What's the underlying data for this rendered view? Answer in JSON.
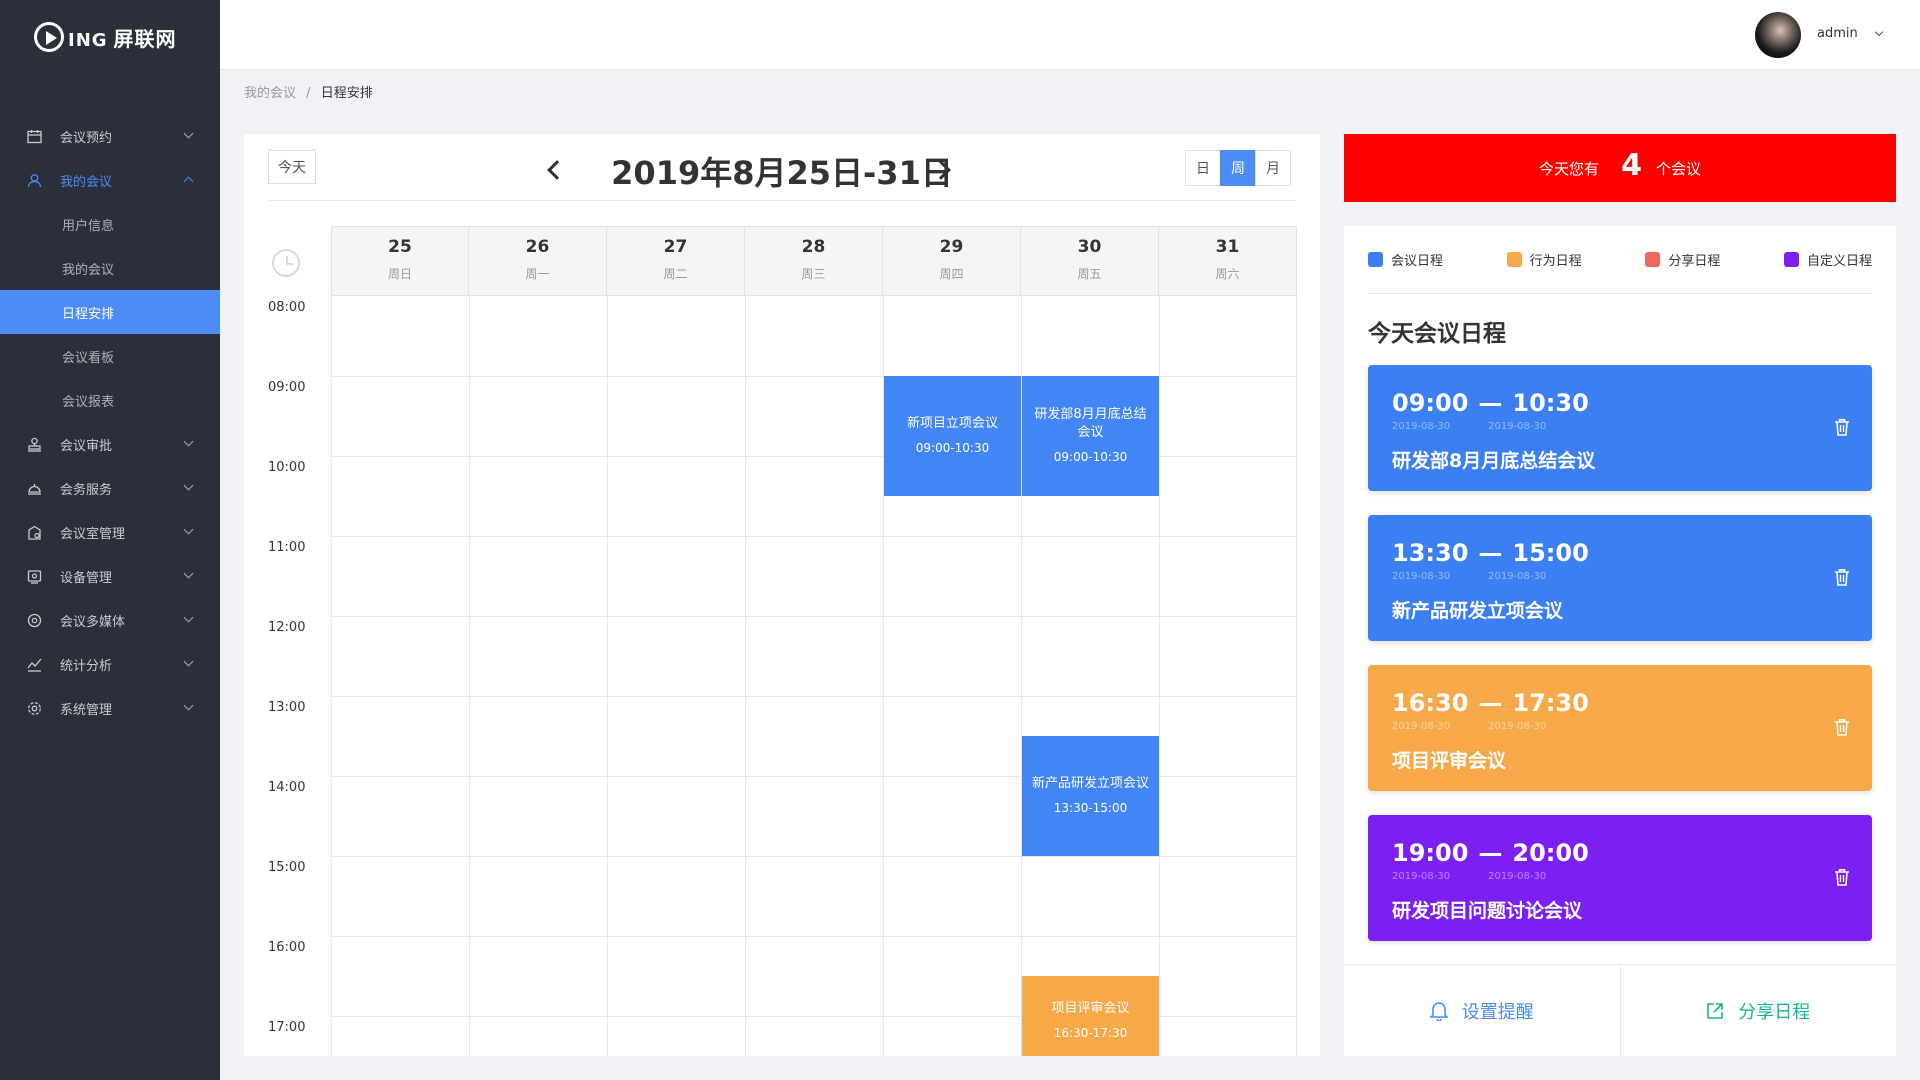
{
  "app": {
    "logo_mark": "ING",
    "logo_name": "屏联网"
  },
  "sidebar": {
    "items": [
      {
        "label": "会议预约",
        "icon": "calendar-icon"
      },
      {
        "label": "我的会议",
        "icon": "user-icon",
        "open": true,
        "children": [
          "用户信息",
          "我的会议",
          "日程安排",
          "会议看板",
          "会议报表"
        ],
        "active_child": "日程安排"
      },
      {
        "label": "会议审批",
        "icon": "stamp-icon"
      },
      {
        "label": "会务服务",
        "icon": "service-icon"
      },
      {
        "label": "会议室管理",
        "icon": "room-icon"
      },
      {
        "label": "设备管理",
        "icon": "device-icon"
      },
      {
        "label": "会议多媒体",
        "icon": "media-icon"
      },
      {
        "label": "统计分析",
        "icon": "chart-icon"
      },
      {
        "label": "系统管理",
        "icon": "gear-icon"
      }
    ]
  },
  "header": {
    "user_name": "admin"
  },
  "breadcrumb": {
    "parent": "我的会议",
    "separator": "/",
    "current": "日程安排"
  },
  "calendar": {
    "today_label": "今天",
    "range_title": "2019年8月25日-31日",
    "views": [
      "日",
      "周",
      "月"
    ],
    "active_view": "周",
    "days": [
      {
        "num": "25",
        "weekday": "周日"
      },
      {
        "num": "26",
        "weekday": "周一"
      },
      {
        "num": "27",
        "weekday": "周二"
      },
      {
        "num": "28",
        "weekday": "周三"
      },
      {
        "num": "29",
        "weekday": "周四"
      },
      {
        "num": "30",
        "weekday": "周五"
      },
      {
        "num": "31",
        "weekday": "周六"
      }
    ],
    "hours": [
      "08:00",
      "09:00",
      "10:00",
      "11:00",
      "12:00",
      "13:00",
      "14:00",
      "15:00",
      "16:00",
      "17:00"
    ],
    "events": [
      {
        "title": "新项目立项会议",
        "time": "09:00-10:30",
        "day": 4,
        "start": 9.0,
        "end": 10.5,
        "color": "#4285f4"
      },
      {
        "title": "研发部8月月底总结会议",
        "time": "09:00-10:30",
        "day": 5,
        "start": 9.0,
        "end": 10.5,
        "color": "#4285f4"
      },
      {
        "title": "新产品研发立项会议",
        "time": "13:30-15:00",
        "day": 5,
        "start": 13.5,
        "end": 15.0,
        "color": "#4285f4"
      },
      {
        "title": "项目评审会议",
        "time": "16:30-17:30",
        "day": 5,
        "start": 16.5,
        "end": 17.5,
        "color": "#f7a94a"
      }
    ]
  },
  "banner": {
    "prefix": "今天您有",
    "count": "4",
    "suffix": "个会议",
    "color": "#ff0000"
  },
  "legend": [
    {
      "label": "会议日程",
      "color": "#3b7ff2"
    },
    {
      "label": "行为日程",
      "color": "#f7a94a"
    },
    {
      "label": "分享日程",
      "color": "#f26660"
    },
    {
      "label": "自定义日程",
      "color": "#7b1ff2"
    }
  ],
  "today_schedule": {
    "title": "今天会议日程",
    "cards": [
      {
        "start": "09:00",
        "end": "10:30",
        "date_start": "2019-08-30",
        "date_end": "2019-08-30",
        "name": "研发部8月月底总结会议",
        "color": "#3b7ff2"
      },
      {
        "start": "13:30",
        "end": "15:00",
        "date_start": "2019-08-30",
        "date_end": "2019-08-30",
        "name": "新产品研发立项会议",
        "color": "#3b7ff2"
      },
      {
        "start": "16:30",
        "end": "17:30",
        "date_start": "2019-08-30",
        "date_end": "2019-08-30",
        "name": "项目评审会议",
        "color": "#f7a94a"
      },
      {
        "start": "19:00",
        "end": "20:00",
        "date_start": "2019-08-30",
        "date_end": "2019-08-30",
        "name": "研发项目问题讨论会议",
        "color": "#7b1ff2"
      }
    ],
    "dash": "—"
  },
  "footer_actions": {
    "remind_label": "设置提醒",
    "share_label": "分享日程"
  }
}
